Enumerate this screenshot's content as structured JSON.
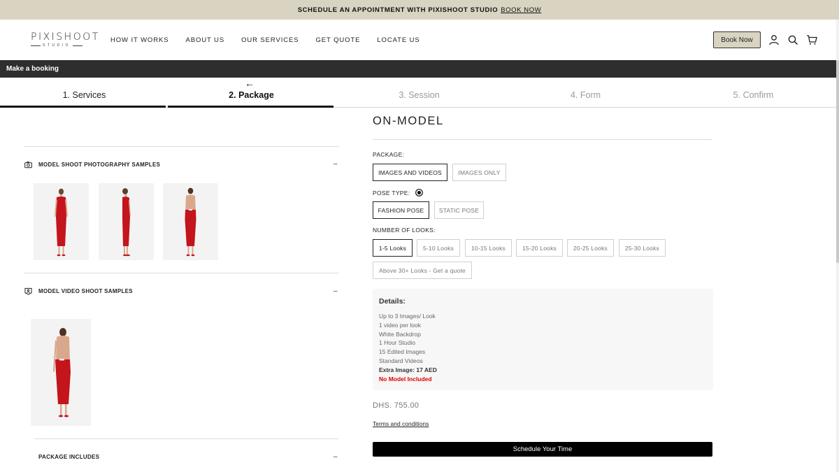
{
  "announcement": {
    "text": "SCHEDULE AN APPOINTMENT WITH PIXISHOOT STUDIO",
    "link": "BOOK NOW"
  },
  "header": {
    "logo": "PIXISHOOT",
    "logo_sub": "STUDIO",
    "nav": [
      "HOW IT WORKS",
      "ABOUT US",
      "OUR SERVICES",
      "GET QUOTE",
      "LOCATE US"
    ],
    "book_now": "Book Now",
    "icons": [
      "user-icon",
      "search-icon",
      "cart-icon"
    ]
  },
  "booking_bar": {
    "title": "Make a booking"
  },
  "steps": {
    "back_arrow": "←",
    "items": [
      "1. Services",
      "2. Package",
      "3. Session",
      "4.  Form",
      "5. Confirm"
    ],
    "active_index": 1
  },
  "left": {
    "photo_section": {
      "title": "MODEL SHOOT PHOTOGRAPHY SAMPLES",
      "toggle": "–"
    },
    "video_section": {
      "title": "MODEL VIDEO SHOOT SAMPLES",
      "toggle": "–"
    },
    "package_section": {
      "title": "PACKAGE INCLUDES",
      "toggle": "–"
    }
  },
  "right": {
    "title": "ON-MODEL",
    "package_label": "PACKAGE:",
    "package_options": [
      "IMAGES AND VIDEOS",
      "IMAGES ONLY"
    ],
    "pose_label": "POSE TYPE:",
    "pose_options": [
      "FASHION POSE",
      "STATIC POSE"
    ],
    "looks_label": "NUMBER OF LOOKS:",
    "looks_options": [
      "1-5 Looks",
      "5-10 Looks",
      "10-15 Looks",
      "15-20 Looks",
      "20-25 Looks",
      "25-30 Looks",
      "Above 30+ Looks - Get a quote"
    ],
    "details": {
      "heading": "Details:",
      "lines": [
        "Up to 3 Images/ Look",
        "1 video per look",
        "White Backdrop",
        "1 Hour Studio",
        "15 Edited Images",
        "Standard Videos"
      ],
      "extra": "Extra Image: 17 AED",
      "warning": "No Model Included"
    },
    "price": "DHS. 755.00",
    "terms": "Terms and conditions",
    "schedule_button": "Schedule Your Time"
  },
  "colors": {
    "announce_bg": "#d9d3c1",
    "dark_bar": "#2e2e2e",
    "dress_red": "#c4141c",
    "warning_red": "#e00000"
  }
}
